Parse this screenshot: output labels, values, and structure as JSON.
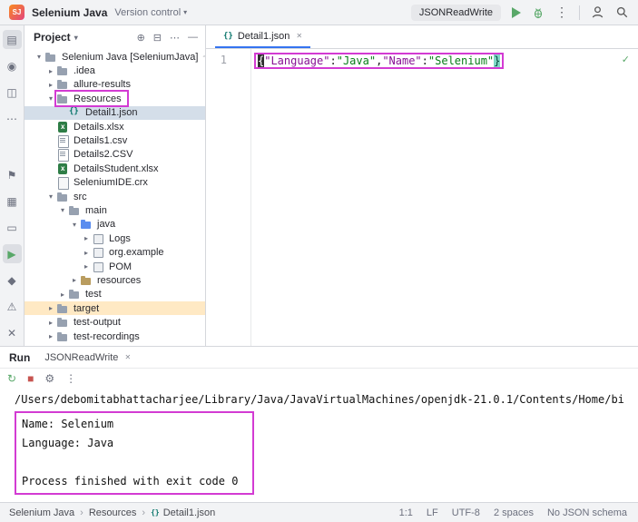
{
  "colors": {
    "highlight_box": "#d33bd3",
    "accent_blue": "#3574F0",
    "run_green": "#59A869",
    "stop_red": "#C75450",
    "tree_selection": "#d4dee9",
    "target_row": "#ffe9c4"
  },
  "title_bar": {
    "app_initials": "SJ",
    "project_name": "Selenium Java",
    "vcs_label": "Version control",
    "run_config": "JSONReadWrite"
  },
  "rail": {
    "top": [
      {
        "name": "project-icon",
        "glyph": "▤",
        "active": true
      },
      {
        "name": "commit-icon",
        "glyph": "◉"
      },
      {
        "name": "structure-icon",
        "glyph": "◫"
      },
      {
        "name": "more-icon",
        "glyph": "⋯"
      }
    ],
    "bottom": [
      {
        "name": "bookmarks-icon",
        "glyph": "⚑"
      },
      {
        "name": "packages-icon",
        "glyph": "▦"
      },
      {
        "name": "terminal-icon",
        "glyph": "▭"
      },
      {
        "name": "run-icon",
        "glyph": "▶",
        "active": true,
        "color": "#59A869"
      },
      {
        "name": "debug-icon",
        "glyph": "◆"
      },
      {
        "name": "problems-icon",
        "glyph": "⚠"
      },
      {
        "name": "trash-icon",
        "glyph": "✕"
      }
    ]
  },
  "project_panel": {
    "header": "Project",
    "header_icons": [
      {
        "name": "locate-icon",
        "glyph": "⊕"
      },
      {
        "name": "collapse-all-icon",
        "glyph": "⊟"
      },
      {
        "name": "more-horizontal-icon",
        "glyph": "⋯"
      },
      {
        "name": "hide-icon",
        "glyph": "—"
      }
    ],
    "tree": [
      {
        "depth": 0,
        "chevron": "down",
        "icon": "folder",
        "label": "Selenium Java [SeleniumJava]",
        "suffix": "~/IdeaProj..."
      },
      {
        "depth": 1,
        "chevron": "right",
        "icon": "folder",
        "label": ".idea"
      },
      {
        "depth": 1,
        "chevron": "right",
        "icon": "folder",
        "label": "allure-results"
      },
      {
        "depth": 1,
        "chevron": "down",
        "icon": "folder",
        "label": "Resources",
        "boxed": true
      },
      {
        "depth": 2,
        "chevron": "none",
        "icon": "json",
        "label": "Detail1.json",
        "selected": true
      },
      {
        "depth": 1,
        "chevron": "none",
        "icon": "xlsx",
        "label": "Details.xlsx"
      },
      {
        "depth": 1,
        "chevron": "none",
        "icon": "csv",
        "label": "Details1.csv"
      },
      {
        "depth": 1,
        "chevron": "none",
        "icon": "csv",
        "label": "Details2.CSV"
      },
      {
        "depth": 1,
        "chevron": "none",
        "icon": "xlsx",
        "label": "DetailsStudent.xlsx"
      },
      {
        "depth": 1,
        "chevron": "none",
        "icon": "file",
        "label": "SeleniumIDE.crx"
      },
      {
        "depth": 1,
        "chevron": "down",
        "icon": "folder",
        "label": "src"
      },
      {
        "depth": 2,
        "chevron": "down",
        "icon": "folder",
        "label": "main"
      },
      {
        "depth": 3,
        "chevron": "down",
        "icon": "folder-src",
        "label": "java"
      },
      {
        "depth": 4,
        "chevron": "right",
        "icon": "package",
        "label": "Logs"
      },
      {
        "depth": 4,
        "chevron": "right",
        "icon": "package",
        "label": "org.example"
      },
      {
        "depth": 4,
        "chevron": "right",
        "icon": "package",
        "label": "POM"
      },
      {
        "depth": 3,
        "chevron": "right",
        "icon": "folder-res",
        "label": "resources"
      },
      {
        "depth": 2,
        "chevron": "right",
        "icon": "folder",
        "label": "test"
      },
      {
        "depth": 1,
        "chevron": "right",
        "icon": "folder",
        "label": "target",
        "row_highlight": true
      },
      {
        "depth": 1,
        "chevron": "right",
        "icon": "folder",
        "label": "test-output"
      },
      {
        "depth": 1,
        "chevron": "right",
        "icon": "folder",
        "label": "test-recordings"
      }
    ]
  },
  "editor": {
    "tab_label": "Detail1.json",
    "tab_icon": "{}",
    "close_glyph": "✕",
    "line_number": "1",
    "inspection_glyph": "✓",
    "tokens": [
      {
        "text": "{",
        "type": "punct caret"
      },
      {
        "text": "\"Language\"",
        "type": "key"
      },
      {
        "text": ":",
        "type": "punct"
      },
      {
        "text": "\"Java\"",
        "type": "string"
      },
      {
        "text": ",",
        "type": "punct"
      },
      {
        "text": "\"Name\"",
        "type": "key"
      },
      {
        "text": ":",
        "type": "punct"
      },
      {
        "text": "\"Selenium\"",
        "type": "string"
      },
      {
        "text": "}",
        "type": "punct match"
      }
    ]
  },
  "run_panel": {
    "title": "Run",
    "tab_label": "JSONReadWrite",
    "close_glyph": "✕",
    "toolbar": [
      {
        "name": "rerun-icon",
        "glyph": "↻",
        "color": "#59A869"
      },
      {
        "name": "stop-icon",
        "glyph": "■",
        "color": "#C75450"
      },
      {
        "name": "settings-icon",
        "glyph": "⚙"
      },
      {
        "name": "more-vertical-icon",
        "glyph": "⋮"
      }
    ],
    "console_path": "/Users/debomitabhattacharjee/Library/Java/JavaVirtualMachines/openjdk-21.0.1/Contents/Home/bi",
    "console_output": [
      "Name: Selenium",
      "Language: Java",
      "",
      "Process finished with exit code 0"
    ]
  },
  "status_bar": {
    "json_icon": "{}",
    "separator": "›",
    "breadcrumbs": [
      {
        "label": "Selenium Java"
      },
      {
        "label": "Resources"
      },
      {
        "label": "Detail1.json",
        "icon": "json"
      }
    ],
    "right": [
      "1:1",
      "LF",
      "UTF-8",
      "2 spaces",
      "No JSON schema"
    ]
  }
}
